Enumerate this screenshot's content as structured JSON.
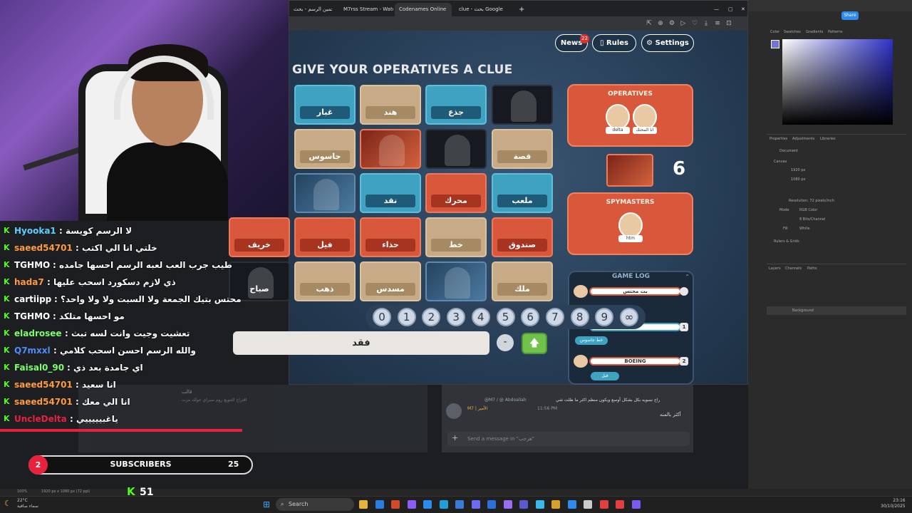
{
  "browser": {
    "tabs": [
      "تخمين الرسم - بحث Google",
      "M7rss Stream - Watch Li...",
      "Codenames Online",
      "clue - بحث Google"
    ],
    "new_tab": "+",
    "window_controls": [
      "—",
      "▢",
      "✕"
    ]
  },
  "game": {
    "news_label": "News",
    "news_badge": "22",
    "rules_label": "Rules",
    "settings_label": "Settings",
    "clue_title": "GIVE YOUR OPERATIVES A CLUE",
    "cards": [
      {
        "word": "غبار",
        "color": "blue"
      },
      {
        "word": "هند",
        "color": "neutral"
      },
      {
        "word": "جذع",
        "color": "blue"
      },
      {
        "word": "",
        "color": "dark"
      },
      {
        "word": "جاسوس",
        "color": "neutral"
      },
      {
        "word": "",
        "color": "pic-red"
      },
      {
        "word": "",
        "color": "dark"
      },
      {
        "word": "قصة",
        "color": "neutral"
      },
      {
        "word": "",
        "color": "pic-blue"
      },
      {
        "word": "نقد",
        "color": "blue"
      },
      {
        "word": "محرك",
        "color": "red"
      },
      {
        "word": "ملعب",
        "color": "blue"
      },
      {
        "word": "خريف",
        "color": "red"
      },
      {
        "word": "فيل",
        "color": "red"
      },
      {
        "word": "حذاء",
        "color": "red"
      },
      {
        "word": "خط",
        "color": "neutral"
      },
      {
        "word": "صندوق",
        "color": "red"
      },
      {
        "word": "صباح",
        "color": "dark"
      },
      {
        "word": "ذهب",
        "color": "neutral"
      },
      {
        "word": "مسدس",
        "color": "neutral"
      },
      {
        "word": "",
        "color": "pic-blue"
      },
      {
        "word": "ملك",
        "color": "neutral"
      }
    ],
    "operatives_title": "OPERATIVES",
    "operatives": [
      "delta",
      "انا المحتك"
    ],
    "spymasters_title": "SPYMASTERS",
    "spymasters": [
      "htm"
    ],
    "score": "6",
    "game_log_title": "GAME LOG",
    "game_log": [
      {
        "text": "بث محتس",
        "num": ""
      },
      {
        "text": "",
        "num": "1"
      },
      {
        "text": "BOEING",
        "num": "2"
      }
    ],
    "log_chips": [
      "خط جاسوس",
      "فيل"
    ],
    "numbers": [
      "0",
      "1",
      "2",
      "3",
      "4",
      "5",
      "6",
      "7",
      "8",
      "9",
      "∞"
    ],
    "clue_input_value": "فقد",
    "minus_label": "-",
    "submit_icon": "🡅"
  },
  "chat": [
    {
      "user": "Hyooka1",
      "msg": ": لا الرسم كويسة",
      "color": "#5ad0ff"
    },
    {
      "user": "saeed54701",
      "msg": ": خلتي انا الي اكتب",
      "color": "#ff9a3c"
    },
    {
      "user": "TGHMO",
      "msg": ": طيب جرب العب لعبه الرسم احسها جامده",
      "color": "#ffffff"
    },
    {
      "user": "hada7",
      "msg": ": ذي لازم دسكورد اسحب عليها",
      "color": "#ff9a3c"
    },
    {
      "user": "cartiipp",
      "msg": ": محتس بتيك الجمعة ولا السبت ولا ولا واحد؟",
      "color": "#ffffff"
    },
    {
      "user": "TGHMO",
      "msg": ": مو احسها متلكد",
      "color": "#ffffff"
    },
    {
      "user": "eladrosee",
      "msg": ": تعشيت وجيت وانت لسه تبث",
      "color": "#7cff6b"
    },
    {
      "user": "Q7mxxl",
      "msg": ": والله الرسم احسن اسحب كلامي",
      "color": "#4f8cff"
    },
    {
      "user": "Faisal0_90",
      "msg": ": اي جامدة بعد ذي",
      "color": "#7cff6b"
    },
    {
      "user": "saeed54701",
      "msg": ": انا سعيد",
      "color": "#ff9a3c"
    },
    {
      "user": "saeed54701",
      "msg": ": انا الي معك",
      "color": "#ff9a3c"
    },
    {
      "user": "UncleDelta",
      "msg": ": ياغبيييييي",
      "color": "#e8213d"
    }
  ],
  "goal": {
    "count": "2",
    "label": "SUBSCRIBERS",
    "target": "25"
  },
  "kick_followers": "51",
  "photoshop": {
    "share": "Share",
    "panels": [
      "Color",
      "Swatches",
      "Gradients",
      "Patterns"
    ],
    "props_tabs": [
      "Properties",
      "Adjustments",
      "Libraries"
    ],
    "document": "Document",
    "canvas": "Canvas",
    "width": "1920 px",
    "height": "1080 px",
    "resolution": "Resolution: 72 pixels/inch",
    "mode_label": "Mode",
    "mode": "RGB Color",
    "bits": "8 Bits/Channel",
    "fill_label": "Fill",
    "fill": "White",
    "rulers": "Rulers & Grids",
    "layers_tabs": [
      "Layers",
      "Channels",
      "Paths"
    ],
    "layer_name": "Background",
    "zoom": "100%",
    "doc_size": "1920 px x 1080 px (72 ppi)"
  },
  "discord": {
    "placeholder": "Send a message in \"هرجب\"",
    "message_meta": "@M7 / @ Abdoallah",
    "message_text": "راح نسويه بكل بشكل أوسع ويكون منظم اكثر ما ظلت شي",
    "message_author": "M7 | الأمير",
    "message_time": "11:56 PM",
    "side_text": "أكثر بالمنه",
    "left_title": "قالب",
    "left_text": "اقتراح التنويع روم سبراي عولك مرت"
  },
  "taskbar": {
    "weather_temp": "22°C",
    "weather_desc": "سماء صافية",
    "search": "Search",
    "time": "23:16",
    "date": "30/10/2025"
  },
  "colors": {
    "kick_green": "#53fc18",
    "team_red": "#d9583b",
    "team_blue": "#3fa2c0",
    "alert_red": "#e8213d"
  }
}
